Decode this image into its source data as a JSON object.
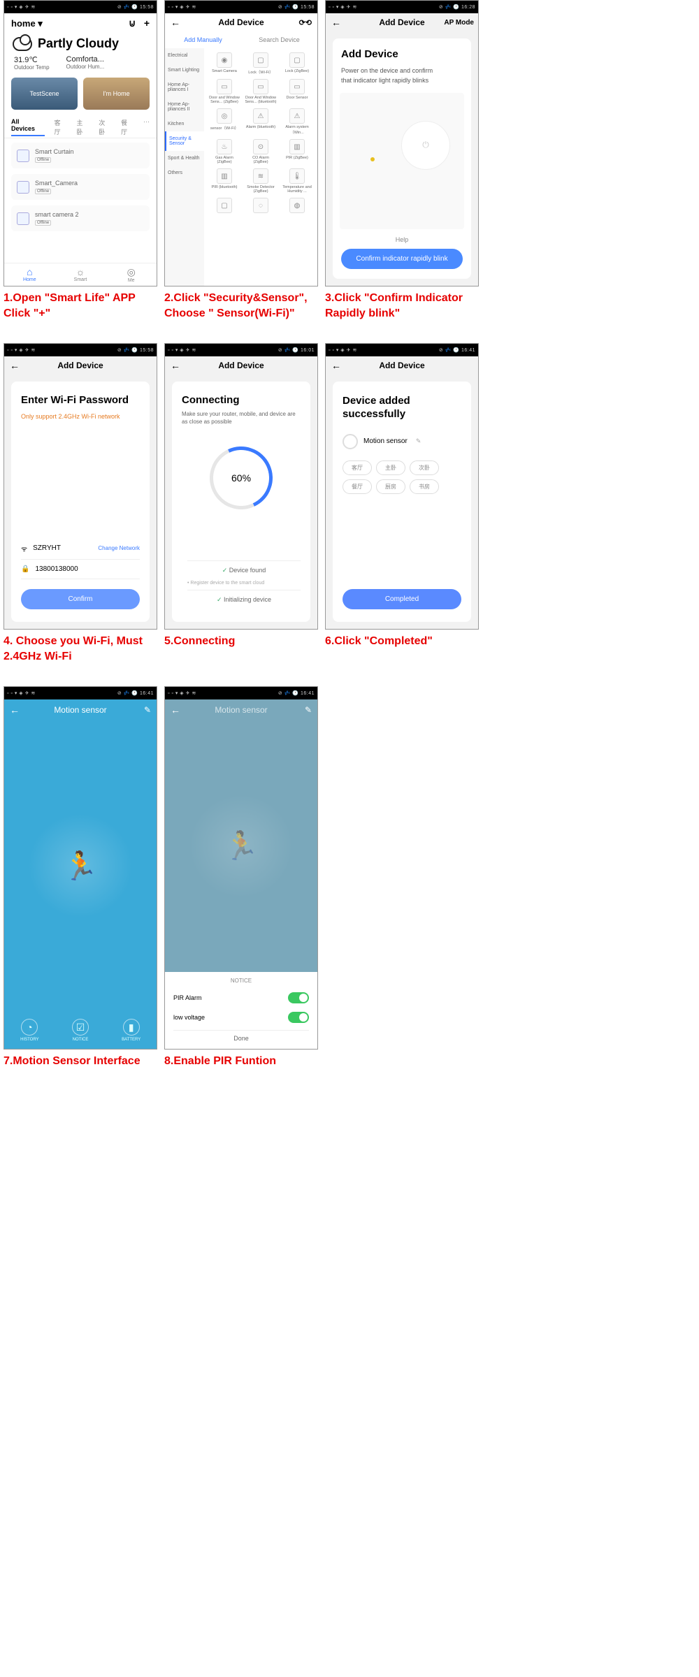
{
  "statusbar": {
    "leftIcons": "▫ ▫ ▾ ◈ ✈ ≋",
    "rightIcons": "⊘ 💤 🕐",
    "t1558": "15:58",
    "t1628": "16:28",
    "t1601": "16:01",
    "t1641": "16:41"
  },
  "screen1": {
    "homeLabel": "home ▾",
    "weather": "Partly Cloudy",
    "temp": "31.9℃",
    "tempLabel": "Outdoor Temp",
    "hum": "Comforta...",
    "humLabel": "Outdoor Hum...",
    "scene1": "TestScene",
    "scene2": "I'm Home",
    "tabs": [
      "All Devices",
      "客厅",
      "主卧",
      "次卧",
      "餐厅"
    ],
    "more": "···",
    "devices": [
      {
        "name": "Smart Curtain",
        "status": "Offline"
      },
      {
        "name": "Smart_Camera",
        "status": "Offline"
      },
      {
        "name": "smart camera 2",
        "status": "Offline"
      }
    ],
    "nav": [
      {
        "icon": "⌂",
        "label": "Home"
      },
      {
        "icon": "☼",
        "label": "Smart"
      },
      {
        "icon": "◎",
        "label": "Me"
      }
    ]
  },
  "screen2": {
    "title": "Add Device",
    "tabAdd": "Add Manually",
    "tabSearch": "Search Device",
    "cats": [
      "Electrical",
      "Smart Lighting",
      "Home Ap-pliances I",
      "Home Ap-pliances II",
      "Kitchen",
      "Security & Sensor",
      "Sport & Health",
      "Others"
    ],
    "items": [
      "Smart Camera",
      "Lock（Wi-Fi）",
      "Lock (ZigBee)",
      "Door and Window Sens... (ZigBee)",
      "Door And Window Sens... (bluetooth)",
      "Door Sensor",
      "sensor（Wi-Fi）",
      "Alarm (bluetooth)",
      "Alarm system（Win...",
      "Gas Alarm (ZigBee)",
      "CO Alarm (ZigBee)",
      "PIR (ZigBee)",
      "PIR (bluetooth)",
      "Smoke Detector (ZigBee)",
      "Temperature and Humidity ...",
      "",
      "",
      ""
    ]
  },
  "screen3": {
    "apmode": "AP Mode",
    "title": "Add Device",
    "heading": "Add Device",
    "line1": "Power on the device and confirm",
    "line2": "that indicator light rapidly blinks",
    "help": "Help",
    "btn": "Confirm indicator rapidly blink"
  },
  "screen4": {
    "title": "Add Device",
    "heading": "Enter Wi-Fi Password",
    "warn": "Only support 2.4GHz Wi-Fi network",
    "ssid": "SZRYHT",
    "change": "Change Network",
    "pwd": "13800138000",
    "btn": "Confirm"
  },
  "screen5": {
    "title": "Add Device",
    "heading": "Connecting",
    "sub": "Make sure your router, mobile, and device are as close as possible",
    "percent": "60%",
    "step1": "Device found",
    "step2": "Register device to the smart cloud",
    "step3": "Initializing device"
  },
  "screen6": {
    "title": "Add Device",
    "heading": "Device added successfully",
    "devname": "Motion sensor",
    "rooms": [
      "客厅",
      "主卧",
      "次卧",
      "餐厅",
      "厨房",
      "书房"
    ],
    "btn": "Completed"
  },
  "screen7": {
    "title": "Motion sensor",
    "tabs": [
      "HISTORY",
      "NOTICE",
      "BATTERY"
    ],
    "icons": [
      "◔",
      "☑",
      "▮"
    ]
  },
  "screen8": {
    "title": "Motion sensor",
    "notice": "NOTICE",
    "row1": "PIR Alarm",
    "row2": "low voltage",
    "done": "Done"
  },
  "captions": {
    "c1": "1.Open \"Smart Life\" APP Click \"+\"",
    "c2": "2.Click \"Security&Sensor\", Choose \" Sensor(Wi-Fi)\"",
    "c3": "3.Click \"Confirm Indicator Rapidly blink\"",
    "c4": "4. Choose you Wi-Fi, Must 2.4GHz Wi-Fi",
    "c5": "5.Connecting",
    "c6": "6.Click \"Completed\"",
    "c7": "7.Motion Sensor Interface",
    "c8": "8.Enable PIR Funtion"
  }
}
